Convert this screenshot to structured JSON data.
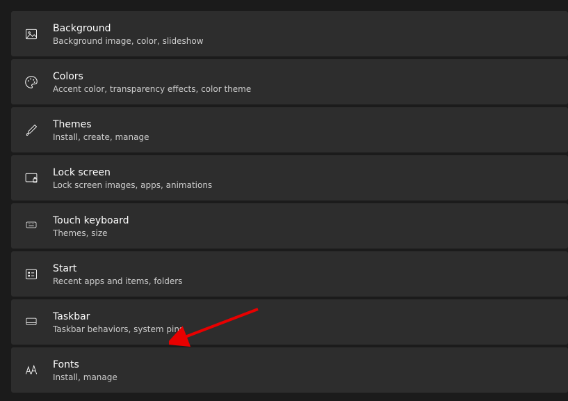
{
  "settings": [
    {
      "key": "background",
      "title": "Background",
      "subtitle": "Background image, color, slideshow"
    },
    {
      "key": "colors",
      "title": "Colors",
      "subtitle": "Accent color, transparency effects, color theme"
    },
    {
      "key": "themes",
      "title": "Themes",
      "subtitle": "Install, create, manage"
    },
    {
      "key": "lock-screen",
      "title": "Lock screen",
      "subtitle": "Lock screen images, apps, animations"
    },
    {
      "key": "touch-keyboard",
      "title": "Touch keyboard",
      "subtitle": "Themes, size"
    },
    {
      "key": "start",
      "title": "Start",
      "subtitle": "Recent apps and items, folders"
    },
    {
      "key": "taskbar",
      "title": "Taskbar",
      "subtitle": "Taskbar behaviors, system pins"
    },
    {
      "key": "fonts",
      "title": "Fonts",
      "subtitle": "Install, manage"
    }
  ]
}
